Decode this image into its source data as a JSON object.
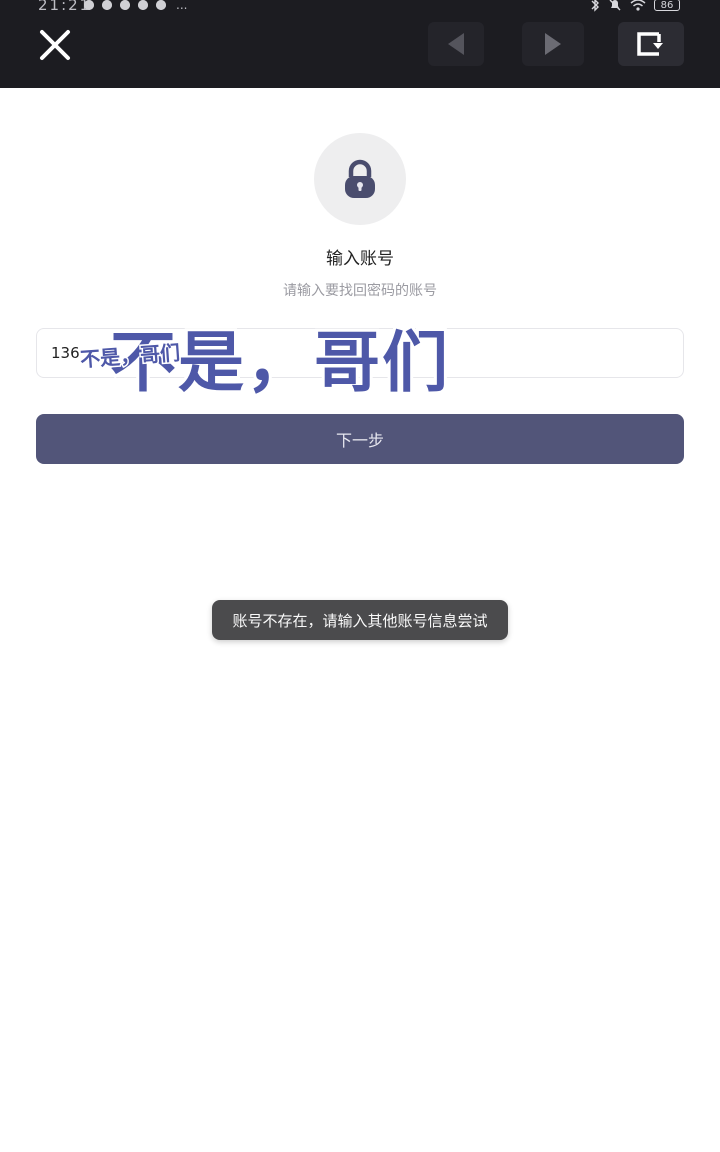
{
  "status_bar": {
    "time": "21:21",
    "more": "...",
    "battery": "86"
  },
  "toolbar": {
    "close_icon": "close-icon",
    "prev_icon": "triangle-left-icon",
    "next_icon": "triangle-right-icon",
    "exit_icon": "exit-window-icon"
  },
  "main": {
    "lock_icon": "lock-icon",
    "title": "输入账号",
    "subtitle": "请输入要找回密码的账号",
    "input_value": "136",
    "next_button": "下一步"
  },
  "overlay": {
    "big_text": "不是，哥们",
    "small_text": "不是，哥们"
  },
  "toast": {
    "message": "账号不存在，请输入其他账号信息尝试"
  },
  "colors": {
    "topbar_bg": "#1c1c21",
    "button_primary": "#525579",
    "toast_bg": "#4b4b4d"
  }
}
